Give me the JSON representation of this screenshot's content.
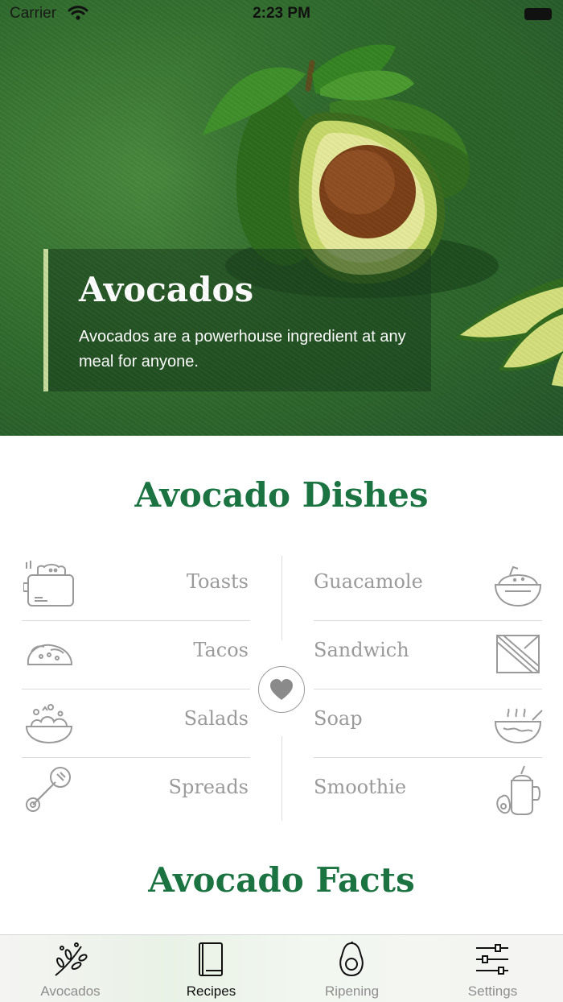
{
  "status_bar": {
    "carrier": "Carrier",
    "time": "2:23 PM"
  },
  "hero": {
    "title": "Avocados",
    "subtitle": "Avocados are a powerhouse ingredient at any meal for anyone.",
    "accent_color": "#c7dc9e"
  },
  "dishes": {
    "title": "Avocado Dishes",
    "left": [
      {
        "label": "Toasts",
        "icon": "toaster-icon"
      },
      {
        "label": "Tacos",
        "icon": "taco-icon"
      },
      {
        "label": "Salads",
        "icon": "salad-bowl-icon"
      },
      {
        "label": "Spreads",
        "icon": "spread-knife-icon"
      }
    ],
    "right": [
      {
        "label": "Guacamole",
        "icon": "guacamole-bowl-icon"
      },
      {
        "label": "Sandwich",
        "icon": "sandwich-icon"
      },
      {
        "label": "Soap",
        "icon": "soup-bowl-icon"
      },
      {
        "label": "Smoothie",
        "icon": "smoothie-jar-icon"
      }
    ],
    "center_icon": "heart-icon"
  },
  "facts": {
    "title": "Avocado Facts"
  },
  "tab_bar": {
    "tabs": [
      {
        "label": "Avocados",
        "icon": "branch-icon",
        "active": false
      },
      {
        "label": "Recipes",
        "icon": "book-icon",
        "active": true
      },
      {
        "label": "Ripening",
        "icon": "avocado-icon",
        "active": false
      },
      {
        "label": "Settings",
        "icon": "sliders-icon",
        "active": false
      }
    ]
  },
  "colors": {
    "brand_green": "#1a7340",
    "muted_text": "#9a9a9a"
  }
}
